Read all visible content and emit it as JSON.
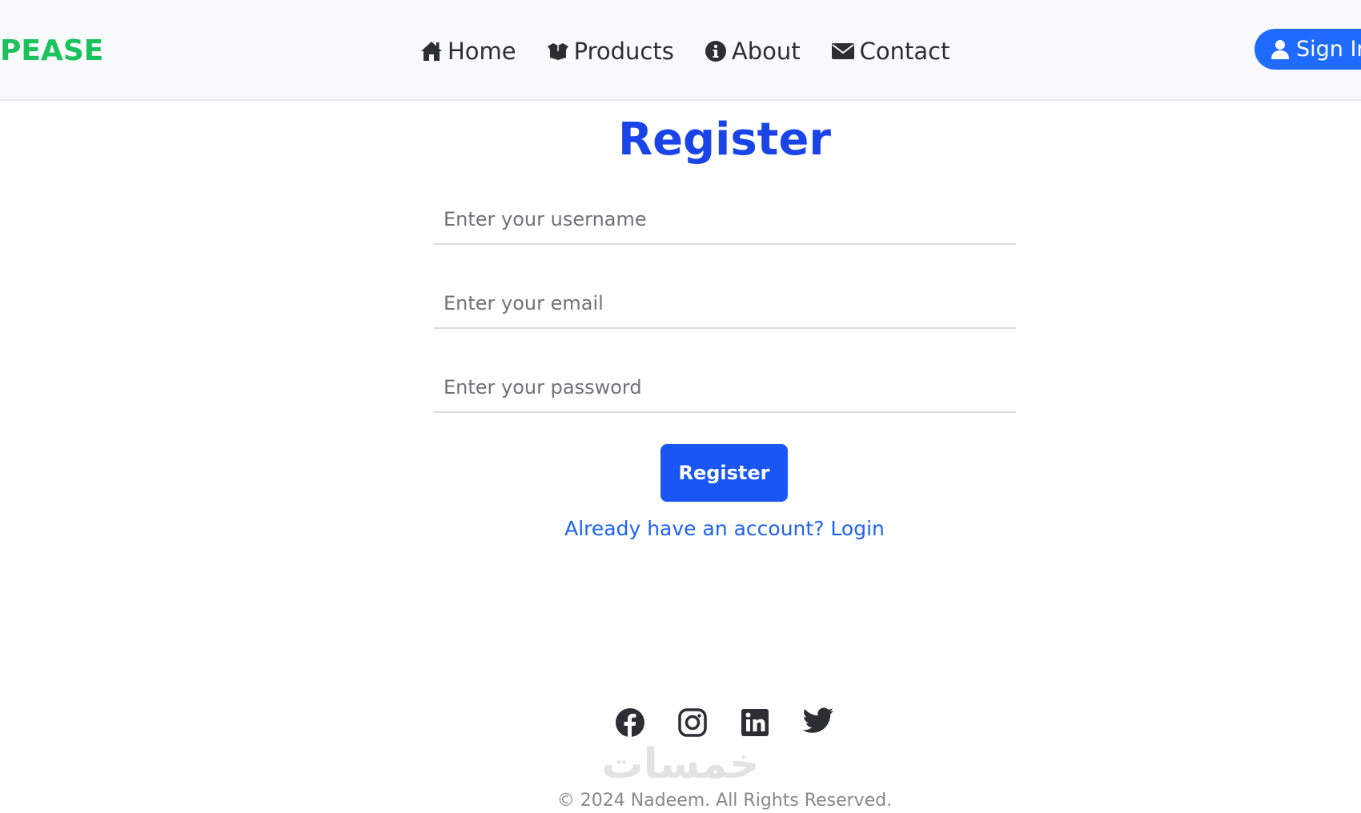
{
  "navbar": {
    "brand": "PEASE",
    "links": [
      {
        "label": "Home",
        "icon": "home-icon"
      },
      {
        "label": "Products",
        "icon": "box-open-icon"
      },
      {
        "label": "About",
        "icon": "info-circle-icon"
      },
      {
        "label": "Contact",
        "icon": "envelope-icon"
      }
    ],
    "signin_label": "Sign In",
    "signin_icon": "user-icon"
  },
  "register": {
    "title": "Register",
    "username_placeholder": "Enter your username",
    "email_placeholder": "Enter your email",
    "password_placeholder": "Enter your password",
    "submit_label": "Register",
    "login_link": "Already have an account? Login"
  },
  "footer": {
    "social_icons": [
      "facebook-icon",
      "instagram-icon",
      "linkedin-icon",
      "twitter-icon"
    ],
    "watermark": "خمسات",
    "copyright": "© 2024 Nadeem. All Rights Reserved."
  },
  "colors": {
    "brand": "#19c25d",
    "primary": "#1a56f4",
    "title": "#1a44e8",
    "navbar_bg": "#f8f9fa"
  }
}
